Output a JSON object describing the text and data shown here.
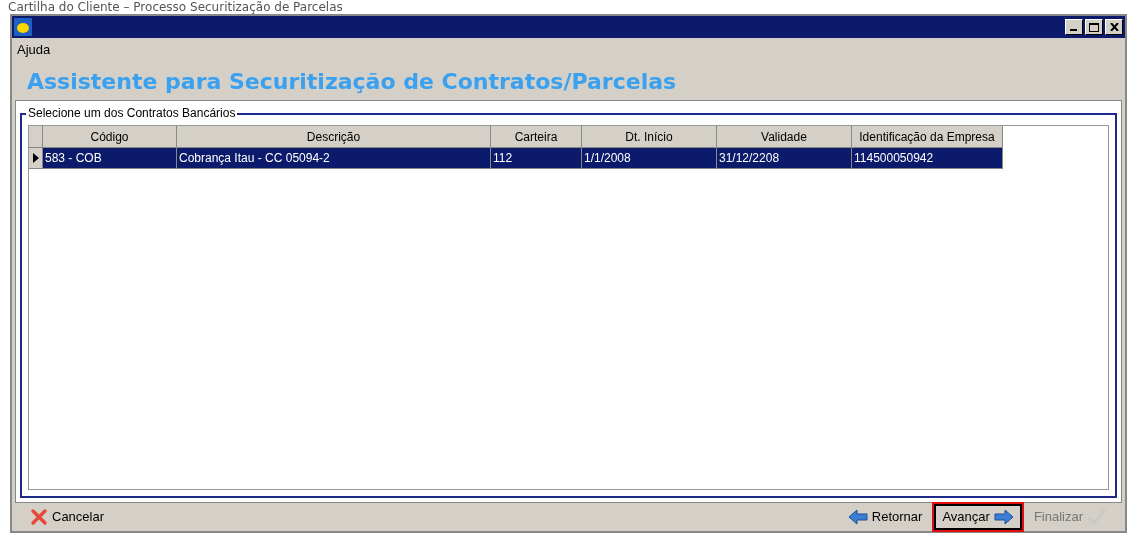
{
  "caption": "Cartilha do Cliente – Processo Securitização de Parcelas",
  "menu": [
    "Ajuda"
  ],
  "heading": "Assistente para Securitização de Contratos/Parcelas",
  "group": {
    "label": "Selecione um dos Contratos Bancários"
  },
  "table": {
    "columns": [
      "Código",
      "Descrição",
      "Carteira",
      "Dt. Início",
      "Validade",
      "Identificação da Empresa"
    ],
    "rows": [
      {
        "selected": true,
        "cells": [
          "583 - COB",
          "Cobrança Itau - CC 05094-2",
          "112",
          "1/1/2008",
          "31/12/2208",
          "114500050942"
        ]
      }
    ]
  },
  "buttons": [
    {
      "kind": "cancel",
      "label": "Cancelar",
      "disabled": false,
      "highlighted": false
    },
    {
      "kind": "back",
      "label": "Retornar",
      "disabled": false,
      "highlighted": false
    },
    {
      "kind": "next",
      "label": "Avançar",
      "disabled": false,
      "highlighted": true
    },
    {
      "kind": "finish",
      "label": "Finalizar",
      "disabled": true,
      "highlighted": false
    }
  ]
}
